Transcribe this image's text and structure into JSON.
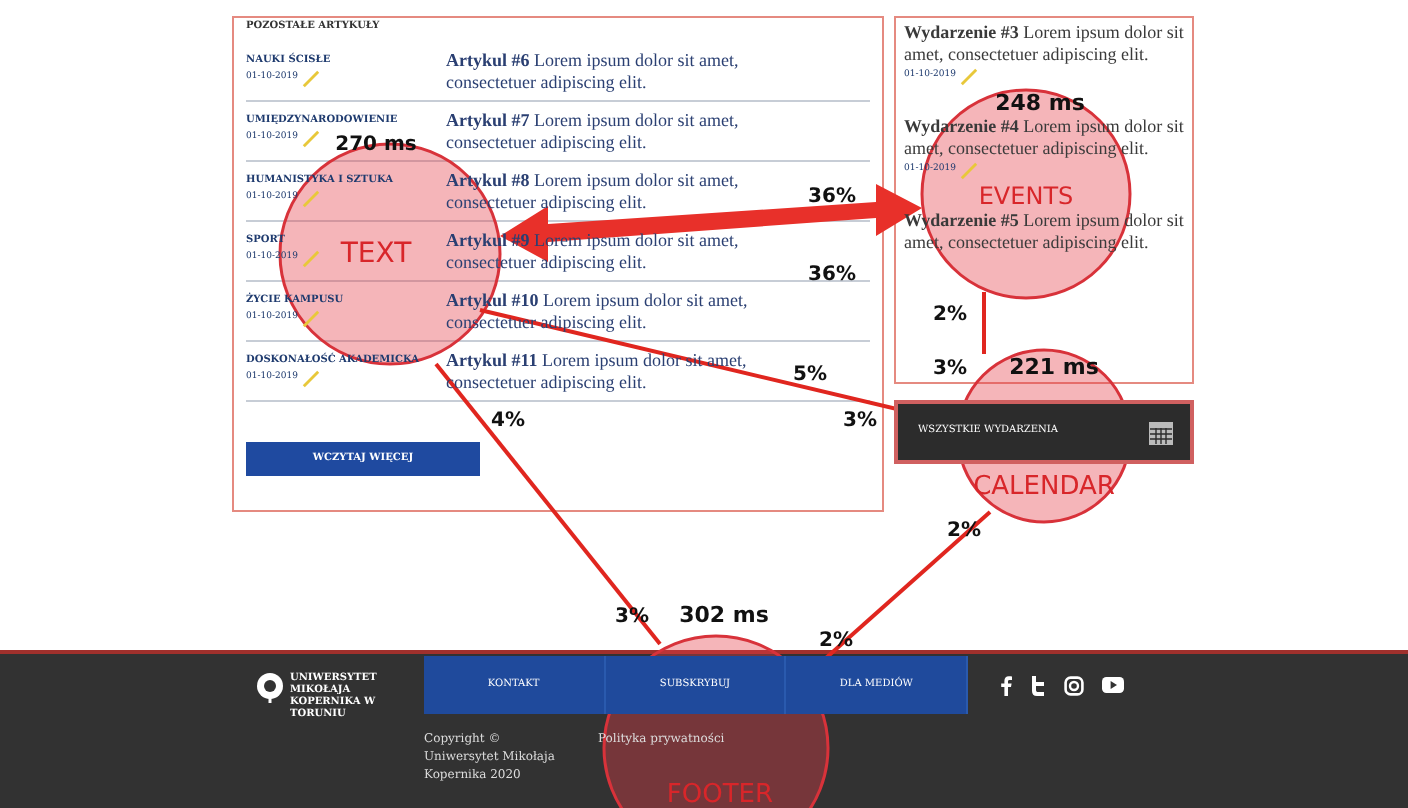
{
  "articles": {
    "heading": "POZOSTAŁE ARTYKUŁY",
    "items": [
      {
        "category": "NAUKI ŚCISŁE",
        "date": "01-10-2019",
        "text": "**Artykul #6** Lorem ipsum dolor sit amet, consectetuer adipiscing elit."
      },
      {
        "category": "UMIĘDZYNARODOWIENIE",
        "date": "01-10-2019",
        "text": "**Artykul #7** Lorem ipsum dolor sit amet, consectetuer adipiscing elit."
      },
      {
        "category": "HUMANISTYKA I SZTUKA",
        "date": "01-10-2019",
        "text": "**Artykul #8** Lorem ipsum dolor sit amet, consectetuer adipiscing elit."
      },
      {
        "category": "SPORT",
        "date": "01-10-2019",
        "text": "**Artykul #9** Lorem ipsum dolor sit amet, consectetuer adipiscing elit."
      },
      {
        "category": "ŻYCIE KAMPUSU",
        "date": "01-10-2019",
        "text": "**Artykul #10** Lorem ipsum dolor sit amet, consectetuer adipiscing elit."
      },
      {
        "category": "DOSKONAŁOŚĆ AKADEMICKA",
        "date": "01-10-2019",
        "text": "**Artykul #11** Lorem ipsum dolor sit amet, consectetuer adipiscing elit."
      }
    ],
    "button": "WCZYTAJ WIĘCEJ"
  },
  "events": {
    "items": [
      {
        "text": "**Wydarzenie #3** Lorem ipsum dolor sit amet, consectetuer adipiscing elit.",
        "date": "01-10-2019"
      },
      {
        "text": "**Wydarzenie #4** Lorem ipsum dolor sit amet, consectetuer adipiscing elit.",
        "date": "01-10-2019"
      },
      {
        "text": "**Wydarzenie #5** Lorem ipsum dolor sit amet, consectetuer adipiscing elit."
      }
    ],
    "calendar_button": "WSZYSTKIE WYDARZENIA"
  },
  "footer": {
    "logo_text": "UNIWERSYTET MIKOŁAJA KOPERNIKA W TORUNIU",
    "nav": [
      {
        "label": "KONTAKT"
      },
      {
        "label": "SUBSKRYBUJ"
      },
      {
        "label": "DLA MEDIÓW"
      }
    ],
    "copyright": "Copyright © Uniwersytet Mikołaja Kopernika 2020",
    "privacy": "Polityka prywatności"
  },
  "overlay": {
    "areas": [
      {
        "label": "TEXT",
        "time": "270 ms"
      },
      {
        "label": "EVENTS",
        "time": "248 ms"
      },
      {
        "label": "CALENDAR",
        "time": "221 ms"
      },
      {
        "label": "FOOTER",
        "time": "302 ms"
      }
    ],
    "transitions": [
      {
        "kind": "wide",
        "from_label": "36%",
        "to_label": "36%"
      },
      {
        "kind": "line",
        "from_label": "5%",
        "to_label": "3%"
      },
      {
        "kind": "line",
        "from_label": "4%",
        "to_label": "3%"
      },
      {
        "kind": "line",
        "from_label": "2%",
        "to_label": "2%"
      },
      {
        "kind": "line",
        "from_label": "2%",
        "to_label": "3%"
      }
    ]
  }
}
